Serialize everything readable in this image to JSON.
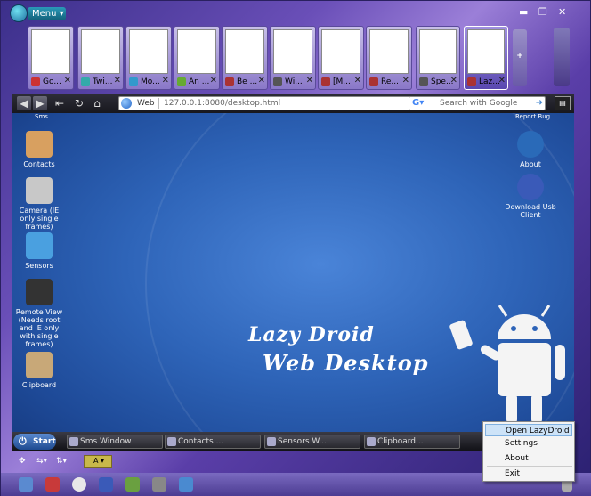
{
  "window": {
    "menu_label": "Menu",
    "minimize": "▬",
    "restore": "❐",
    "close": "✕"
  },
  "tabs": [
    {
      "label": "Go...",
      "fav": "#c33"
    },
    {
      "label": "Twi...",
      "fav": "#3aa"
    },
    {
      "label": "Mo...",
      "fav": "#39c"
    },
    {
      "label": "An ...",
      "fav": "#6a3"
    },
    {
      "label": "Be ...",
      "fav": "#a33"
    },
    {
      "label": "Wi...",
      "fav": "#555"
    },
    {
      "label": "[M...",
      "fav": "#a33"
    },
    {
      "label": "Re...",
      "fav": "#a33"
    },
    {
      "label": "Spe...",
      "fav": "#555"
    },
    {
      "label": "Laz...",
      "fav": "#a33"
    }
  ],
  "toolbar": {
    "address_mode": "Web",
    "url": "127.0.0.1:8080/desktop.html",
    "search_placeholder": "Search with Google"
  },
  "desktop": {
    "top_left_fragment": "Sms",
    "top_right_fragment": "Report Bug",
    "icons_left": [
      {
        "label": "Contacts",
        "color": "#d8a060"
      },
      {
        "label": "Camera (IE only single frames)",
        "color": "#c8c8c8"
      },
      {
        "label": "Sensors",
        "color": "#4aa0e0"
      },
      {
        "label": "Remote View (Needs root and IE only with single frames)",
        "color": "#333333"
      },
      {
        "label": "Clipboard",
        "color": "#c8a878"
      }
    ],
    "icons_right": [
      {
        "label": "About",
        "color": "#2a6ab8"
      },
      {
        "label": "Download Usb Client",
        "color": "#3a5ab8"
      }
    ],
    "brand_line1": "Lazy Droid",
    "brand_line2": "Web Desktop"
  },
  "taskbar": {
    "start_label": "Start",
    "windows": [
      "Sms Window",
      "Contacts ...",
      "Sensors W...",
      "Clipboard..."
    ]
  },
  "context_menu": {
    "items": [
      "Open LazyDroid",
      "Settings",
      "About",
      "Exit"
    ]
  },
  "statusbar": {
    "zoom": "A"
  }
}
